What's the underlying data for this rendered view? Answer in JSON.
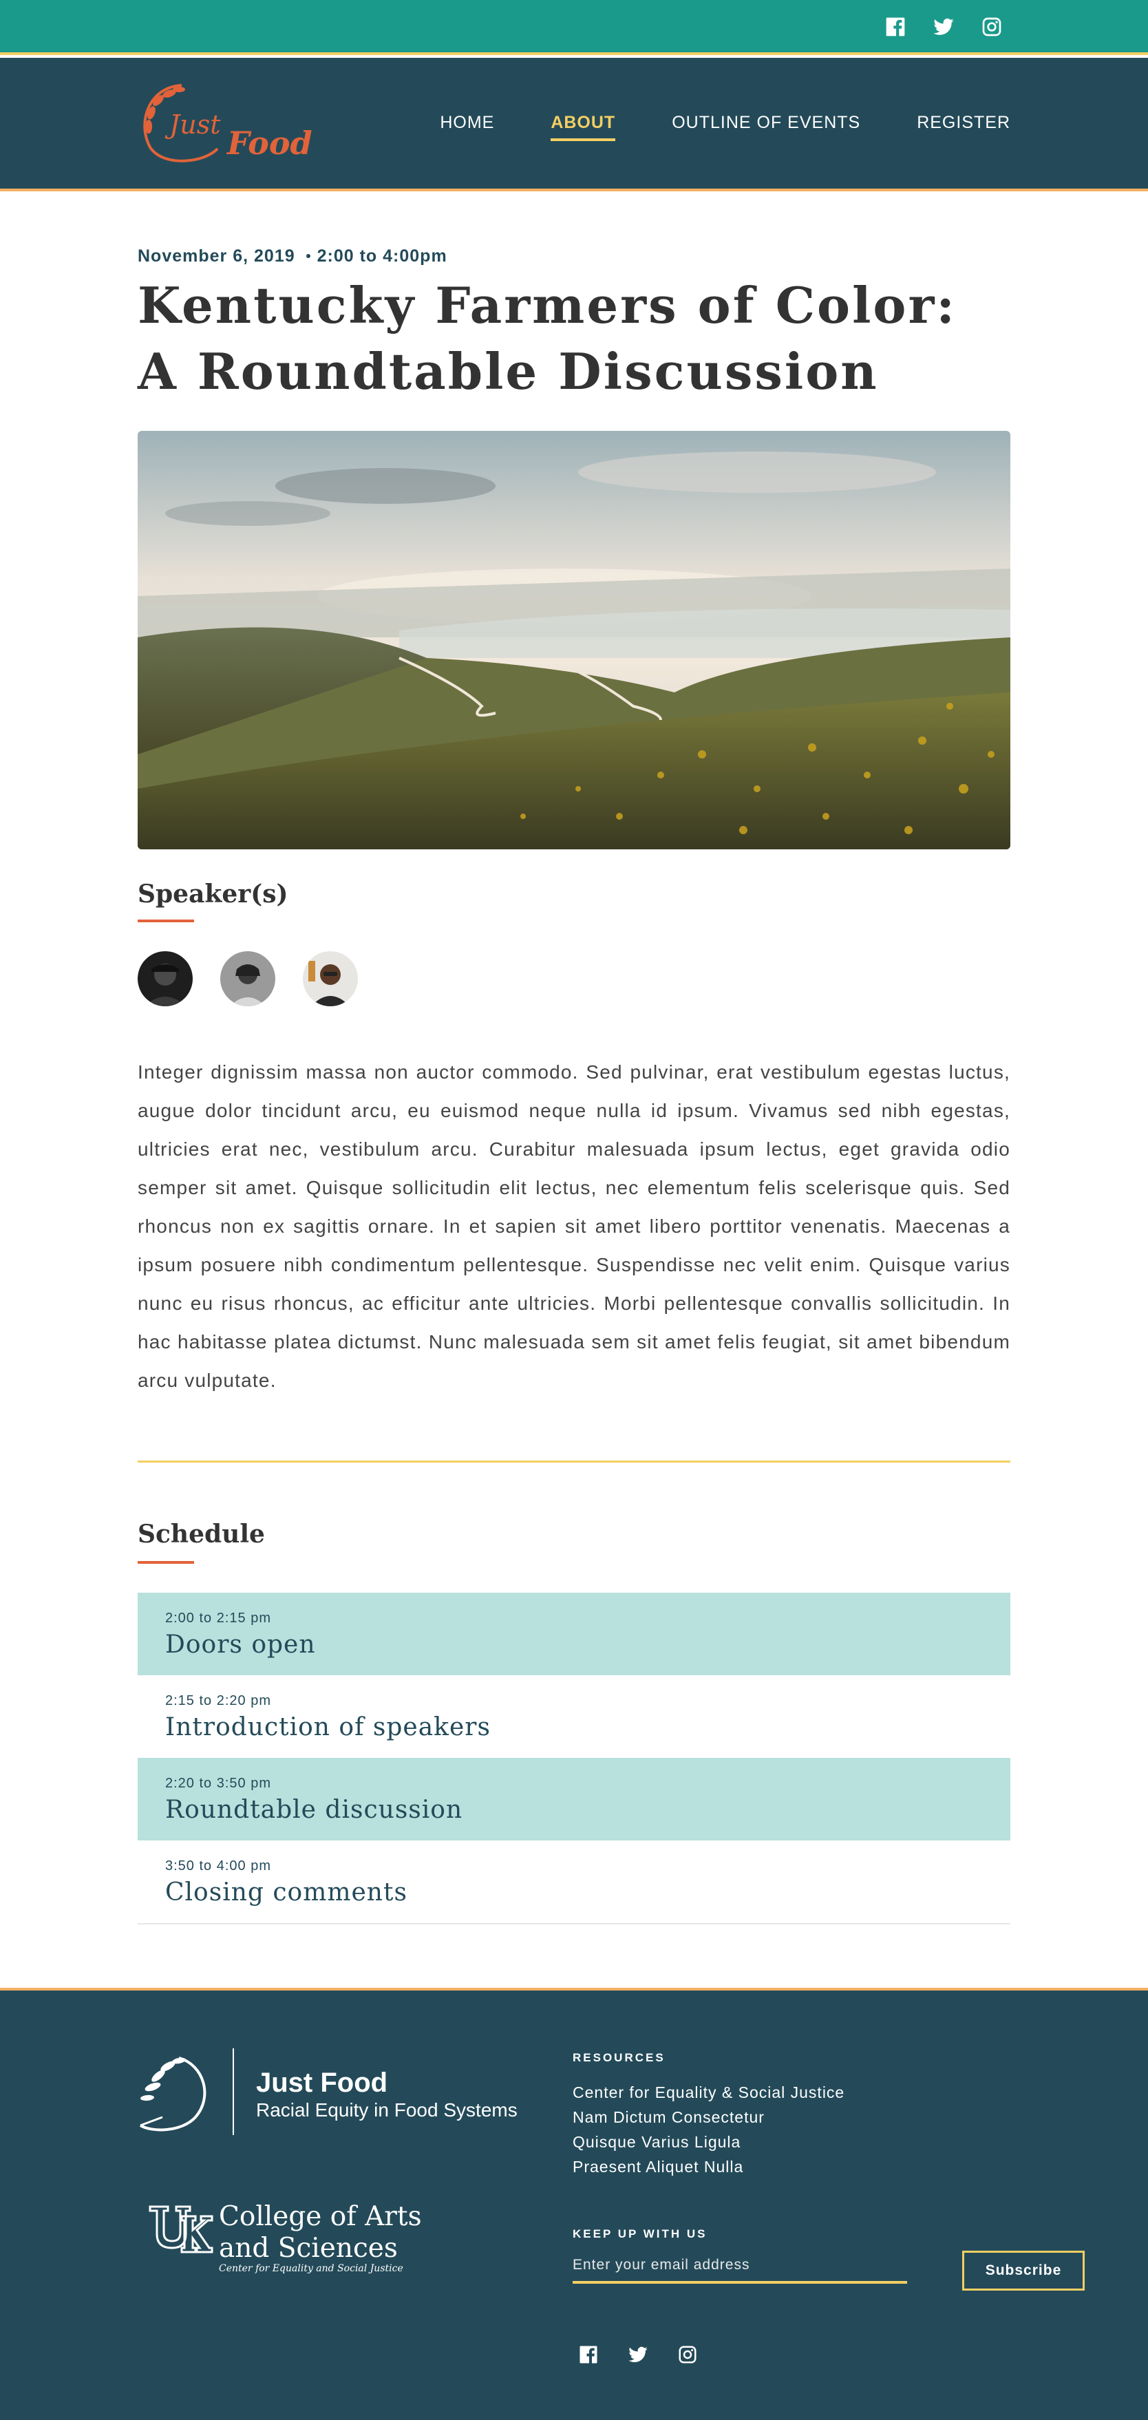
{
  "topbar": {
    "social": [
      {
        "name": "facebook-icon"
      },
      {
        "name": "twitter-icon"
      },
      {
        "name": "instagram-icon"
      }
    ]
  },
  "header": {
    "logo_text": "Just Food",
    "nav": [
      {
        "label": "HOME",
        "active": false
      },
      {
        "label": "ABOUT",
        "active": true
      },
      {
        "label": "OUTLINE OF EVENTS",
        "active": false
      },
      {
        "label": "REGISTER",
        "active": false
      }
    ]
  },
  "event": {
    "date": "November 6, 2019",
    "time": "2:00 to 4:00pm",
    "title": "Kentucky Farmers of Color: A Roundtable Discussion",
    "speakers_heading": "Speaker(s)",
    "bio": "Integer dignissim massa non auctor commodo. Sed pulvinar, erat vestibulum egestas luctus, augue dolor tincidunt arcu, eu euismod neque nulla id ipsum. Vivamus sed nibh egestas, ultricies erat nec, vestibulum arcu. Curabitur malesuada ipsum lectus, eget gravida odio semper sit amet. Quisque sollicitudin elit lectus, nec elementum felis scelerisque quis. Sed rhoncus non ex sagittis ornare. In et sapien sit amet libero porttitor venenatis. Maecenas a ipsum posuere nibh condimentum pellentesque. Suspendisse nec velit enim. Quisque varius nunc eu risus rhoncus, ac efficitur ante ultricies. Morbi pellentesque convallis sollicitudin. In hac habitasse platea dictumst. Nunc malesuada sem sit amet felis feugiat, sit amet bibendum arcu vulputate."
  },
  "schedule": {
    "heading": "Schedule",
    "items": [
      {
        "time": "2:00 to 2:15 pm",
        "name": "Doors open"
      },
      {
        "time": "2:15 to 2:20 pm",
        "name": "Introduction of speakers"
      },
      {
        "time": "2:20 to 3:50 pm",
        "name": "Roundtable discussion"
      },
      {
        "time": "3:50 to 4:00 pm",
        "name": "Closing comments"
      }
    ]
  },
  "footer": {
    "brand_name": "Just Food",
    "brand_tagline": "Racial Equity in Food Systems",
    "college_line1": "College of Arts",
    "college_line2": "and Sciences",
    "college_sub": "Center for Equality and Social Justice",
    "resources_heading": "RESOURCES",
    "resources": [
      "Center for Equality & Social Justice",
      "Nam Dictum Consectetur",
      "Quisque Varius Ligula",
      "Praesent Aliquet Nulla"
    ],
    "keep_heading": "KEEP UP WITH US",
    "email_placeholder": "Enter your email address",
    "subscribe_label": "Subscribe"
  },
  "colors": {
    "teal": "#1a9a8b",
    "navy": "#244a59",
    "gold": "#f4cf62",
    "orange": "#e2633a",
    "light_teal": "#b8e0dd"
  }
}
